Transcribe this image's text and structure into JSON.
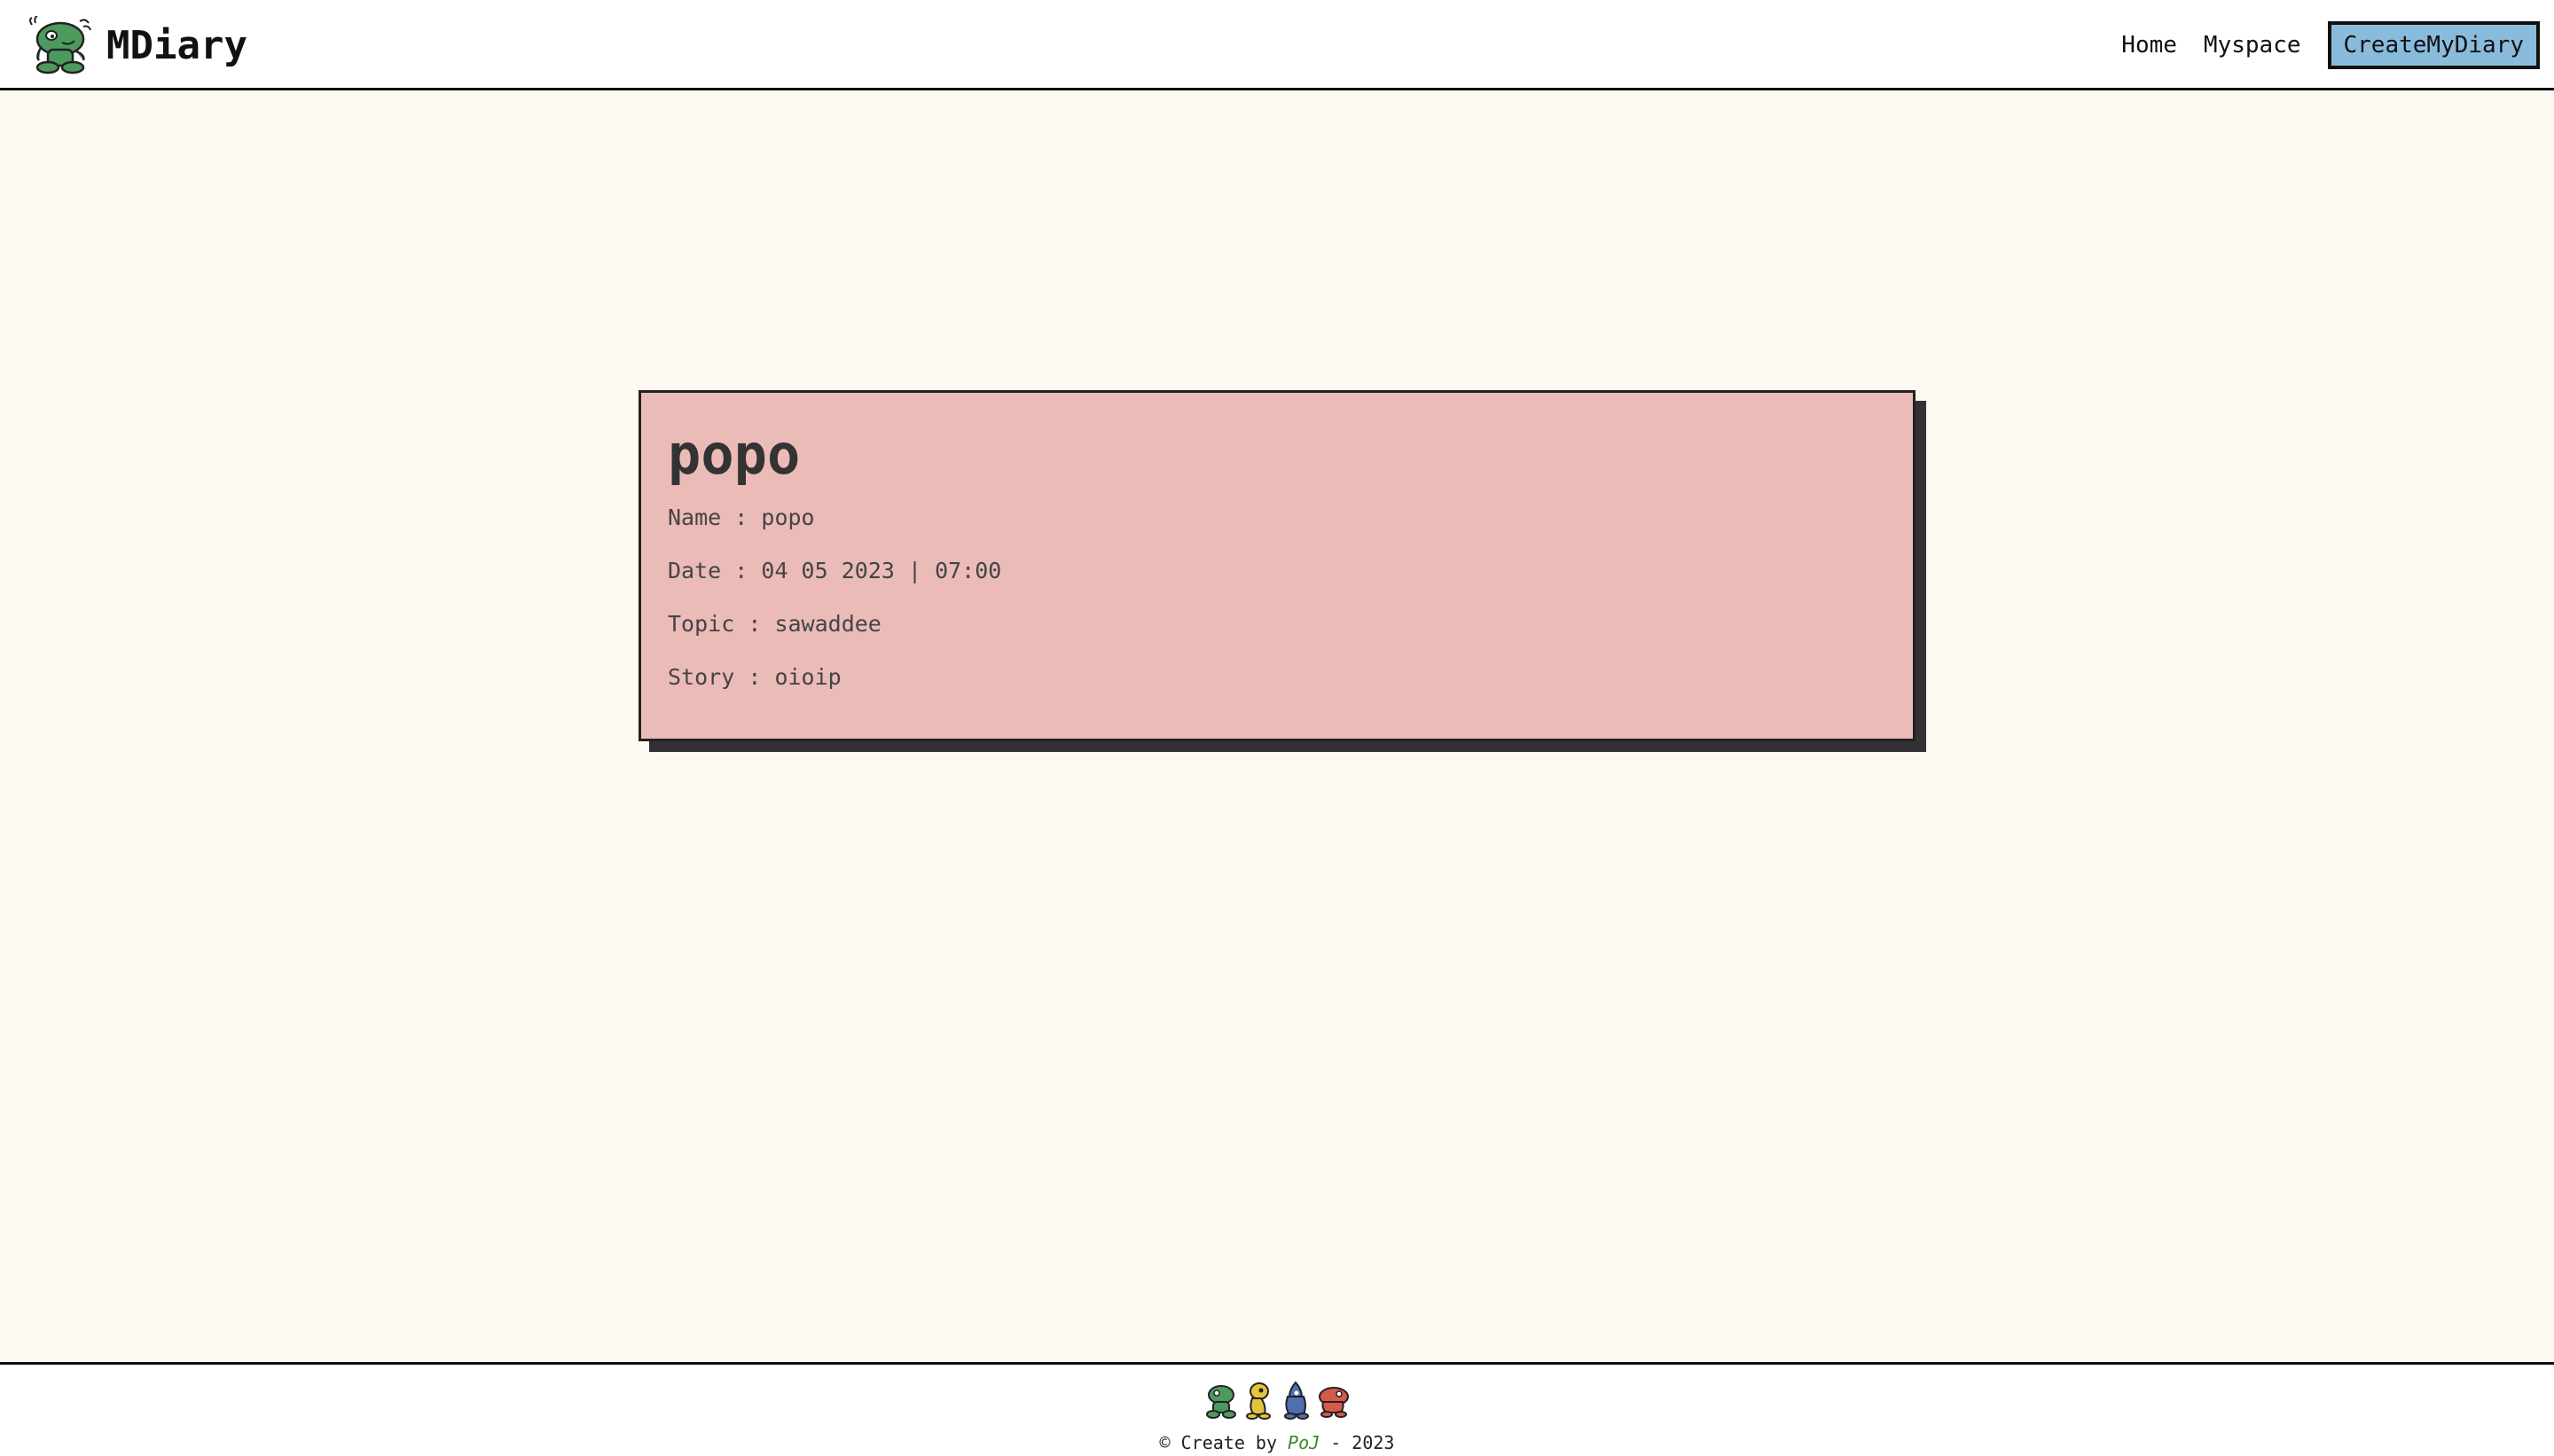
{
  "header": {
    "brand": "MDiary",
    "logo_icon": "green-monster-icon",
    "nav": {
      "home": "Home",
      "myspace": "Myspace",
      "create": "CreateMyDiary"
    }
  },
  "diary": {
    "title": "popo",
    "name_label": "Name",
    "name_value": "popo",
    "date_label": "Date",
    "date_value": "04 05 2023 | 07:00",
    "topic_label": "Topic",
    "topic_value": "sawaddee",
    "story_label": "Story",
    "story_value": "oioip",
    "separator": ":"
  },
  "footer": {
    "copyright_symbol": "©",
    "create_by": "Create by",
    "author": "PoJ",
    "dash": "-",
    "year": "2023",
    "mascots": [
      "green-monster-icon",
      "yellow-monster-icon",
      "blue-monster-icon",
      "red-monster-icon"
    ]
  },
  "colors": {
    "page_bg": "#fdf8f1",
    "card_bg": "#ebbbb8",
    "card_shadow": "#333133",
    "cta_bg": "#89bbdc",
    "author_color": "#3a8a2a"
  }
}
